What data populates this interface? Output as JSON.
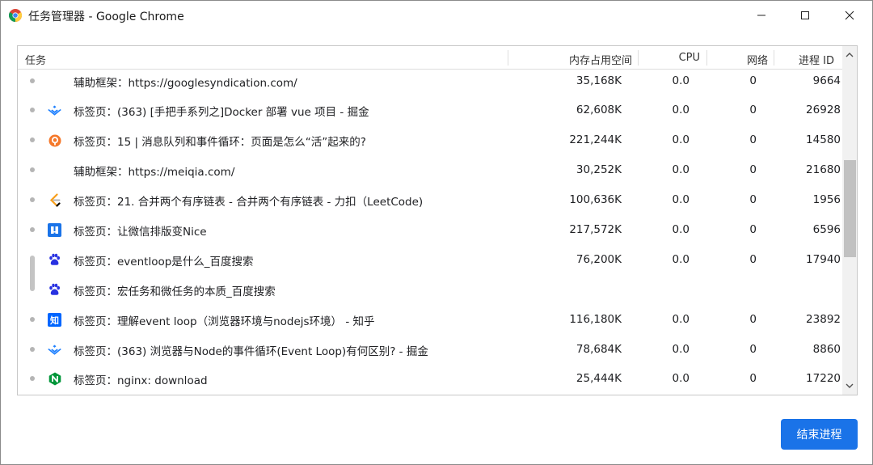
{
  "window": {
    "title": "任务管理器 - Google Chrome",
    "app_icon": "chrome-logo-icon"
  },
  "table": {
    "headers": {
      "task": "任务",
      "memory": "内存占用空间",
      "cpu": "CPU",
      "network": "网络",
      "pid": "进程 ID"
    },
    "rows": [
      {
        "icon": "none",
        "name": "辅助框架：https://googlesyndication.com/",
        "memory": "35,168K",
        "cpu": "0.0",
        "network": "0",
        "pid": "9664"
      },
      {
        "icon": "juejin-icon",
        "name": "标签页：(363) [手把手系列之]Docker 部署 vue 项目 - 掘金",
        "memory": "62,608K",
        "cpu": "0.0",
        "network": "0",
        "pid": "26928"
      },
      {
        "icon": "geekbang-icon",
        "name": "标签页：15 | 消息队列和事件循环：页面是怎么“活”起来的?",
        "memory": "221,244K",
        "cpu": "0.0",
        "network": "0",
        "pid": "14580"
      },
      {
        "icon": "none",
        "name": "辅助框架：https://meiqia.com/",
        "memory": "30,252K",
        "cpu": "0.0",
        "network": "0",
        "pid": "21680"
      },
      {
        "icon": "leetcode-icon",
        "name": "标签页：21. 合并两个有序链表 - 合并两个有序链表 - 力扣（LeetCode)",
        "memory": "100,636K",
        "cpu": "0.0",
        "network": "0",
        "pid": "1956"
      },
      {
        "icon": "mdnice-icon",
        "name": "标签页：让微信排版变Nice",
        "memory": "217,572K",
        "cpu": "0.0",
        "network": "0",
        "pid": "6596"
      },
      {
        "icon": "baidu-paw-icon",
        "name": "标签页：eventloop是什么_百度搜索",
        "memory": "76,200K",
        "cpu": "0.0",
        "network": "0",
        "pid": "17940"
      },
      {
        "icon": "baidu-paw-icon",
        "name": "标签页：宏任务和微任务的本质_百度搜索",
        "memory": "",
        "cpu": "",
        "network": "",
        "pid": ""
      },
      {
        "icon": "zhihu-icon",
        "name": "标签页：理解event loop（浏览器环境与nodejs环境） - 知乎",
        "memory": "116,180K",
        "cpu": "0.0",
        "network": "0",
        "pid": "23892"
      },
      {
        "icon": "juejin-icon",
        "name": "标签页：(363) 浏览器与Node的事件循环(Event Loop)有何区别? - 掘金",
        "memory": "78,684K",
        "cpu": "0.0",
        "network": "0",
        "pid": "8860"
      },
      {
        "icon": "nginx-icon",
        "name": "标签页：nginx: download",
        "memory": "25,444K",
        "cpu": "0.0",
        "network": "0",
        "pid": "17220"
      }
    ]
  },
  "buttons": {
    "end_process": "结束进程"
  },
  "colors": {
    "accent": "#1a73e8",
    "zhihu": "#0066ff",
    "juejin": "#1e80ff",
    "nginx": "#009639",
    "leetcode_orange": "#f89f1b",
    "geekbang_orange": "#f5782a",
    "baidu": "#2932e1"
  }
}
